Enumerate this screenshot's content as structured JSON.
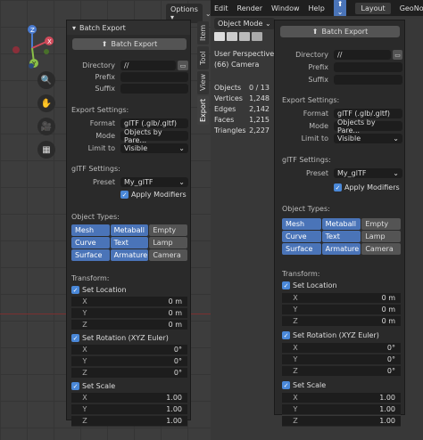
{
  "menubar": {
    "items": [
      "Edit",
      "Render",
      "Window",
      "Help"
    ],
    "workspace_tabs": [
      "Layout",
      "GeoNo"
    ]
  },
  "viewport": {
    "options_label": "Options",
    "object_mode": "Object Mode",
    "perspective": "User Perspective",
    "camera": "(66) Camera"
  },
  "stats": [
    {
      "k": "Objects",
      "v": "0 / 13"
    },
    {
      "k": "Vertices",
      "v": "1,248"
    },
    {
      "k": "Edges",
      "v": "2,142"
    },
    {
      "k": "Faces",
      "v": "1,215"
    },
    {
      "k": "Triangles",
      "v": "2,227"
    }
  ],
  "side_tabs": [
    "Item",
    "Tool",
    "View",
    "Export"
  ],
  "panel": {
    "title": "Batch Export",
    "button": "Batch Export",
    "directory_label": "Directory",
    "directory_value": "//",
    "prefix_label": "Prefix",
    "suffix_label": "Suffix",
    "export_settings": "Export Settings:",
    "format_label": "Format",
    "format_value": "glTF (.glb/.gltf)",
    "mode_label": "Mode",
    "mode_value_left": "Objects by Pare...",
    "mode_value_right": "Objects by Pare...",
    "limit_label": "Limit to",
    "limit_value": "Visible",
    "gltf_settings": "glTF Settings:",
    "preset_label": "Preset",
    "preset_value": "My_glTF",
    "apply_modifiers": "Apply Modifiers",
    "object_types": "Object Types:",
    "types": [
      [
        "Mesh",
        "on"
      ],
      [
        "Metaball",
        "on"
      ],
      [
        "Empty",
        "off"
      ],
      [
        "Curve",
        "on"
      ],
      [
        "Text",
        "on"
      ],
      [
        "Lamp",
        "off"
      ],
      [
        "Surface",
        "on"
      ],
      [
        "Armature",
        "on"
      ],
      [
        "Camera",
        "off"
      ]
    ],
    "transform": "Transform:",
    "set_location": "Set Location",
    "set_rotation": "Set Rotation (XYZ Euler)",
    "set_scale": "Set Scale",
    "location": [
      {
        "k": "X",
        "v": "0 m"
      },
      {
        "k": "Y",
        "v": "0 m"
      },
      {
        "k": "Z",
        "v": "0 m"
      }
    ],
    "rotation": [
      {
        "k": "X",
        "v": "0°"
      },
      {
        "k": "Y",
        "v": "0°"
      },
      {
        "k": "Z",
        "v": "0°"
      }
    ],
    "scale": [
      {
        "k": "X",
        "v": "1.00"
      },
      {
        "k": "Y",
        "v": "1.00"
      },
      {
        "k": "Z",
        "v": "1.00"
      }
    ]
  }
}
